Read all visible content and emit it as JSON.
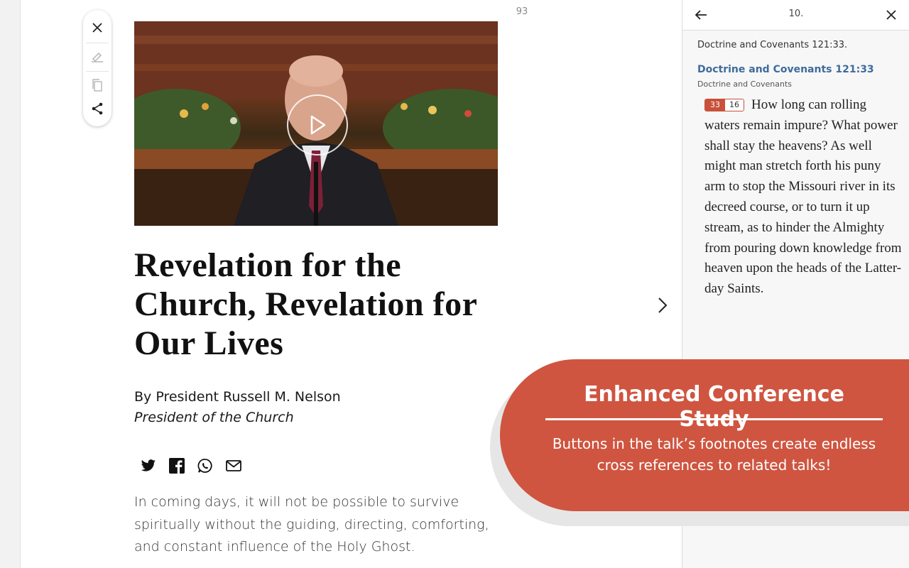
{
  "toolbar": {
    "icons": [
      "close-icon",
      "highlight-icon",
      "copy-icon",
      "share-icon"
    ]
  },
  "article": {
    "page_number": "93",
    "title": "Revelation for the Church, Revelation for Our Lives",
    "byline": "By President Russell M. Nelson",
    "role": "President of the Church",
    "share_icons": [
      "twitter-icon",
      "facebook-icon",
      "whatsapp-icon",
      "email-icon"
    ],
    "lede": "In coming days, it will not be possible to survive spiritually without the guiding, directing, comforting, and constant influence of the Holy Ghost."
  },
  "footnote_panel": {
    "title": "10.",
    "reference_text": "Doctrine and Covenants 121:33.",
    "reference_link": "Doctrine and Covenants 121:33",
    "book": "Doctrine and Covenants",
    "verse_number": "33",
    "cross_ref_count": "16",
    "verse_text": "How long can rolling waters remain impure? What power shall stay the heavens? As well might man stretch forth his puny arm to stop the Missouri river in its decreed course, or to turn it up stream, as to hinder the Almighty from pouring down knowledge from heaven upon the heads of the Latter-day Saints."
  },
  "promo": {
    "title": "Enhanced Conference Study",
    "body": "Buttons in the talk’s footnotes create endless cross references to related talks!"
  },
  "colors": {
    "accent": "#cf5540",
    "link": "#3d6b9c"
  }
}
